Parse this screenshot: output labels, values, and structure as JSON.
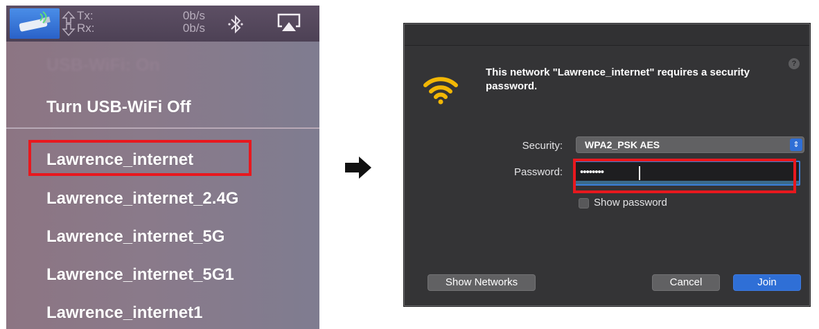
{
  "menubar": {
    "tx_label": "Tx:",
    "rx_label": "Rx:",
    "tx_rate": "0b/s",
    "rx_rate": "0b/s",
    "icons": [
      "usb-wifi-icon",
      "tx-rx-arrows-icon",
      "bluetooth-icon",
      "airplay-icon"
    ]
  },
  "dropdown": {
    "turn_off": "Turn USB-WiFi Off",
    "networks": [
      "Lawrence_internet",
      "Lawrence_internet_2.4G",
      "Lawrence_internet_5G",
      "Lawrence_internet_5G1",
      "Lawrence_internet1"
    ]
  },
  "dialog": {
    "help": "?",
    "message": "This network \"Lawrence_internet\" requires a security password.",
    "security_label": "Security:",
    "security_value": "WPA2_PSK AES",
    "password_label": "Password:",
    "password_value": "••••••••",
    "show_password_label": "Show password",
    "show_networks_button": "Show Networks",
    "cancel_button": "Cancel",
    "join_button": "Join"
  },
  "colors": {
    "highlight": "#e8181e",
    "accent_blue": "#2f6fd6",
    "wifi_yellow": "#f2b705"
  }
}
